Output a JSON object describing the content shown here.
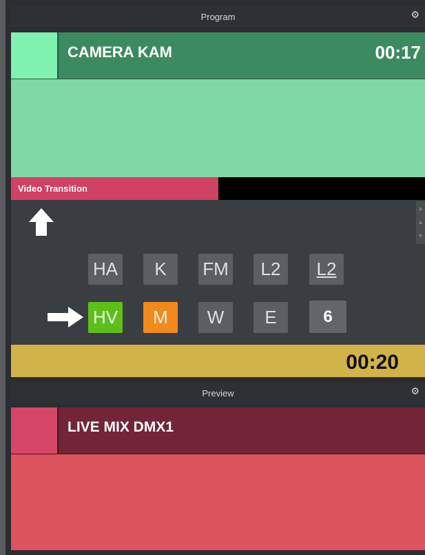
{
  "program": {
    "header": "Program",
    "name": "CAMERA KAM",
    "time": "00:17",
    "swatch_color": "#7ef2ae",
    "row_color": "#3c8a60",
    "body_color": "#80d8a4"
  },
  "transition": {
    "label": "Video Transition",
    "progress_fraction": 0.5,
    "fill_color": "#d04164"
  },
  "buttons": {
    "row1": [
      {
        "label": "HA"
      },
      {
        "label": "K"
      },
      {
        "label": "FM"
      },
      {
        "label": "L2"
      },
      {
        "label": "L2"
      }
    ],
    "row2": [
      {
        "label": "HV",
        "state": "active-green"
      },
      {
        "label": "M",
        "state": "active-orange"
      },
      {
        "label": "W"
      },
      {
        "label": "E"
      },
      {
        "label": "6"
      }
    ]
  },
  "icons": {
    "up": "arrow-up-icon",
    "right": "arrow-right-icon",
    "gear": "gear-icon"
  },
  "timer": {
    "value": "00:20",
    "color": "#d2b34a"
  },
  "preview": {
    "header": "Preview",
    "name": "LIVE MIX DMX1",
    "swatch_color": "#d64767",
    "row_color": "#722538",
    "body_color": "#dc535d"
  }
}
